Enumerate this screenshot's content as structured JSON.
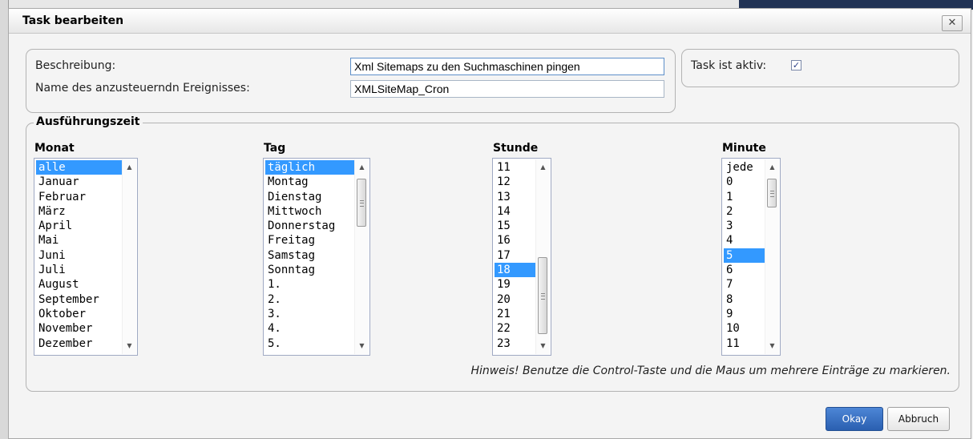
{
  "dialog": {
    "title": "Task bearbeiten",
    "close_symbol": "✕"
  },
  "form": {
    "beschreibung_label": "Beschreibung:",
    "beschreibung_value": "Xml Sitemaps zu den Suchmaschinen pingen",
    "ereignis_label": "Name des anzusteuerndn Ereignisses:",
    "ereignis_value": "XMLSiteMap_Cron",
    "aktiv_label": "Task ist aktiv:",
    "aktiv_checked": true,
    "aktiv_check_glyph": "✓"
  },
  "schedule": {
    "legend": "Ausführungszeit",
    "monat": {
      "header": "Monat",
      "items": [
        "alle",
        "Januar",
        "Februar",
        "März",
        "April",
        "Mai",
        "Juni",
        "Juli",
        "August",
        "September",
        "Oktober",
        "November",
        "Dezember"
      ],
      "selected": "alle"
    },
    "tag": {
      "header": "Tag",
      "items": [
        "täglich",
        "Montag",
        "Dienstag",
        "Mittwoch",
        "Donnerstag",
        "Freitag",
        "Samstag",
        "Sonntag",
        "1.",
        "2.",
        "3.",
        "4.",
        "5."
      ],
      "selected": "täglich"
    },
    "stunde": {
      "header": "Stunde",
      "items": [
        "11",
        "12",
        "13",
        "14",
        "15",
        "16",
        "17",
        "18",
        "19",
        "20",
        "21",
        "22",
        "23"
      ],
      "selected": "18"
    },
    "minute": {
      "header": "Minute",
      "items": [
        "jede",
        "0",
        "1",
        "2",
        "3",
        "4",
        "5",
        "6",
        "7",
        "8",
        "9",
        "10",
        "11"
      ],
      "selected": "5"
    },
    "hint": "Hinweis! Benutze die Control-Taste und die Maus um mehrere Einträge zu markieren."
  },
  "buttons": {
    "okay": "Okay",
    "cancel": "Abbruch"
  },
  "icons": {
    "scroll_up": "▲",
    "scroll_down": "▼"
  },
  "colors": {
    "selection": "#3399ff",
    "primary_button": "#2a5fb0"
  }
}
